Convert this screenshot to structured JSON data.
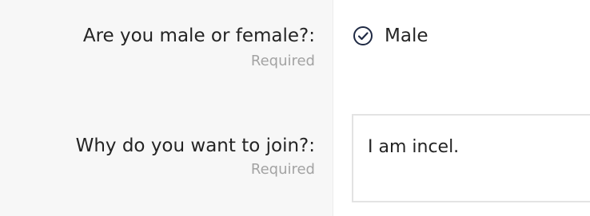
{
  "form": {
    "gender": {
      "label": "Are you male or female?:",
      "hint": "Required",
      "selected_option": "Male",
      "selected_icon": "check-circle-icon"
    },
    "reason": {
      "label": "Why do you want to join?:",
      "hint": "Required",
      "value": "I am incel."
    }
  },
  "colors": {
    "label_panel_bg": "#f7f7f7",
    "hint_text": "#a3a3a3",
    "icon_stroke": "#1f2a44",
    "input_border": "#e3e3e3"
  }
}
